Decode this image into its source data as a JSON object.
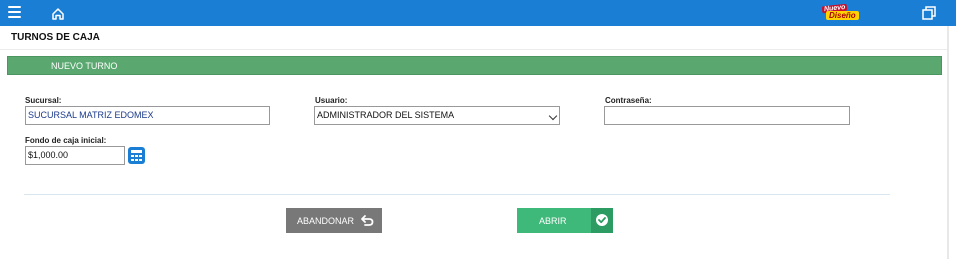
{
  "topbar": {
    "menu_icon": "hamburger-icon",
    "home_icon": "home-icon",
    "badge": {
      "line1": "Nuevo",
      "line2": "Diseño"
    },
    "restore_icon": "restore-window-icon",
    "color": "#1a7fd4"
  },
  "page": {
    "title": "TURNOS DE CAJA"
  },
  "section": {
    "title": "NUEVO TURNO",
    "color": "#5aa86f"
  },
  "form": {
    "sucursal": {
      "label": "Sucursal:",
      "value": "SUCURSAL MATRIZ EDOMEX"
    },
    "usuario": {
      "label": "Usuario:",
      "value": "ADMINISTRADOR DEL SISTEMA"
    },
    "contrasena": {
      "label": "Contraseña:",
      "value": ""
    },
    "fondo": {
      "label": "Fondo de caja inicial:",
      "value": "$1,000.00",
      "icon": "calculator-icon"
    }
  },
  "buttons": {
    "abandonar": {
      "label": "ABANDONAR",
      "icon": "undo-arrow-icon",
      "color": "#787878"
    },
    "abrir": {
      "label": "ABRIR",
      "icon": "check-circle-icon",
      "color": "#3fb97a"
    }
  }
}
